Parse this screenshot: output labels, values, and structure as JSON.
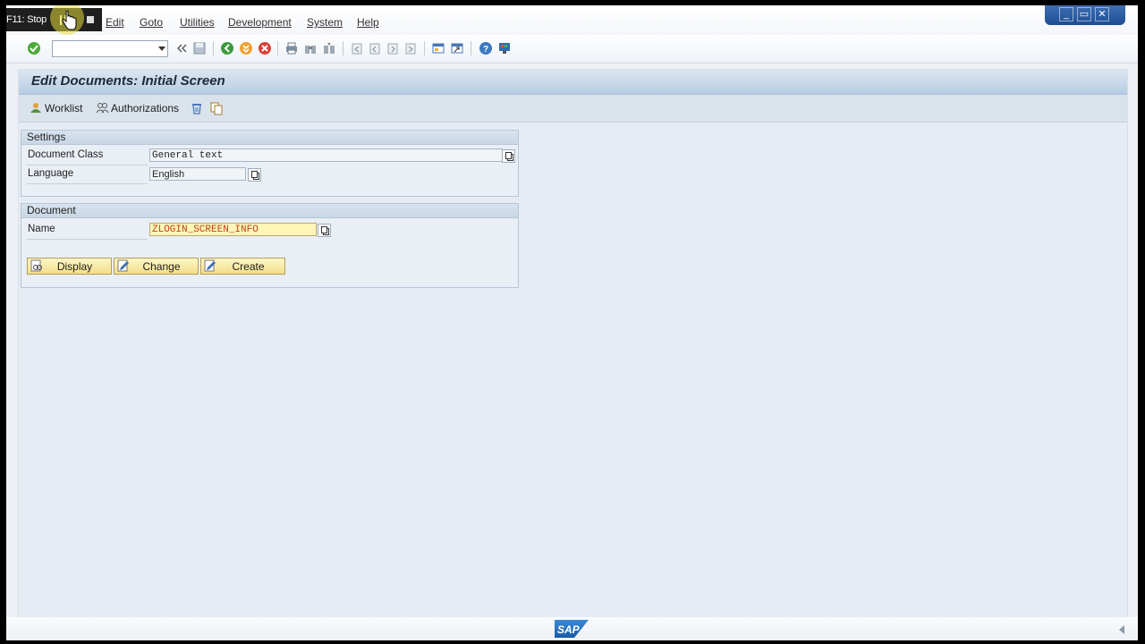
{
  "recorder": {
    "label": "F11: Stop"
  },
  "menu": {
    "items": [
      {
        "label": "Edit"
      },
      {
        "label": "Goto"
      },
      {
        "label": "Utilities"
      },
      {
        "label": "Development"
      },
      {
        "label": "System"
      },
      {
        "label": "Help"
      }
    ]
  },
  "window_controls": {
    "minimize": "_",
    "restore": "▭",
    "close": "✕"
  },
  "command_field": {
    "value": ""
  },
  "screen": {
    "title": "Edit Documents: Initial Screen",
    "app_toolbar": {
      "worklist": "Worklist",
      "authorizations": "Authorizations"
    }
  },
  "settings": {
    "title": "Settings",
    "document_class_label": "Document Class",
    "document_class_value": "General text",
    "language_label": "Language",
    "language_value": "English"
  },
  "document": {
    "title": "Document",
    "name_label": "Name",
    "name_value": "ZLOGIN_SCREEN_INFO",
    "buttons": {
      "display": "Display",
      "change": "Change",
      "create": "Create"
    }
  },
  "status": {
    "logo_text": "SAP"
  }
}
